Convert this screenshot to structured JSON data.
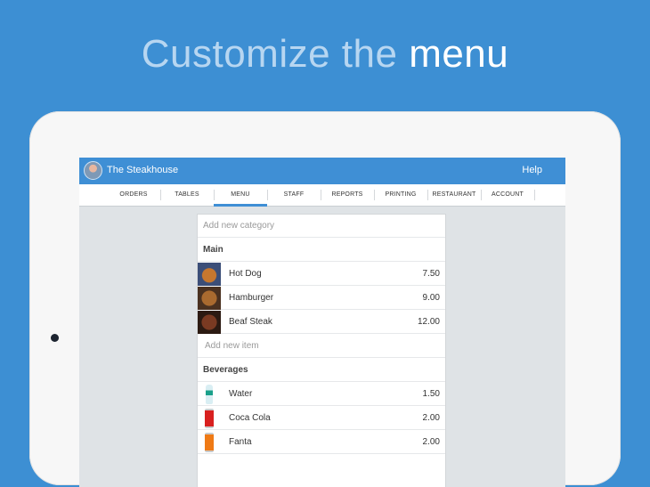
{
  "headline": {
    "light": "Customize the",
    "strong": "menu"
  },
  "app": {
    "title": "The Steakhouse",
    "help": "Help"
  },
  "tabs": [
    "ORDERS",
    "TABLES",
    "MENU",
    "STAFF",
    "REPORTS",
    "PRINTING",
    "RESTAURANT",
    "ACCOUNT"
  ],
  "active_tab": "MENU",
  "menu": {
    "add_category": "Add new category",
    "main": {
      "title": "Main",
      "items": [
        {
          "name": "Hot Dog",
          "price": "7.50",
          "icon": "hot-dog-photo"
        },
        {
          "name": "Hamburger",
          "price": "9.00",
          "icon": "hamburger-photo"
        },
        {
          "name": "Beaf Steak",
          "price": "12.00",
          "icon": "steak-photo"
        }
      ],
      "add_item": "Add new item"
    },
    "beverages": {
      "title": "Beverages",
      "items": [
        {
          "name": "Water",
          "price": "1.50",
          "icon": "water-bottle-icon"
        },
        {
          "name": "Coca Cola",
          "price": "2.00",
          "icon": "coca-cola-can-icon"
        },
        {
          "name": "Fanta",
          "price": "2.00",
          "icon": "fanta-can-icon"
        }
      ]
    }
  },
  "colors": {
    "background": "#3d8fd3",
    "appbar": "#3f8fd5",
    "tablet": "#f7f7f7"
  }
}
